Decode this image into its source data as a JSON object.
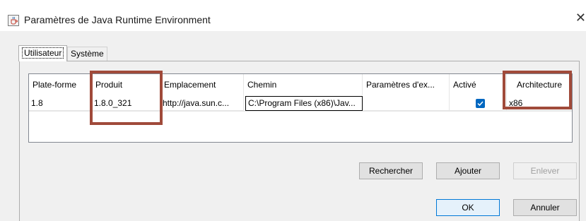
{
  "window": {
    "title": "Paramètres de Java Runtime Environment",
    "close_glyph": "✕"
  },
  "tabs": [
    {
      "label": "Utilisateur",
      "active": true
    },
    {
      "label": "Système",
      "active": false
    }
  ],
  "table": {
    "columns": [
      "Plate-forme",
      "Produit",
      "Emplacement",
      "Chemin",
      "Paramètres d'ex...",
      "Activé",
      "Architecture"
    ],
    "rows": [
      {
        "platform": "1.8",
        "product": "1.8.0_321",
        "location": "http://java.sun.c...",
        "path": "C:\\Program Files (x86)\\Jav...",
        "params": "",
        "enabled": true,
        "architecture": "x86"
      }
    ]
  },
  "buttons": {
    "search": "Rechercher",
    "add": "Ajouter",
    "remove": "Enlever",
    "ok": "OK",
    "cancel": "Annuler"
  },
  "icons": {
    "app": "java-cup-icon",
    "close": "close-icon",
    "check": "checkmark-icon"
  },
  "colors": {
    "highlight": "#a04a3a",
    "checkbox": "#0067c0",
    "dialog_bg": "#f0f0f0"
  }
}
